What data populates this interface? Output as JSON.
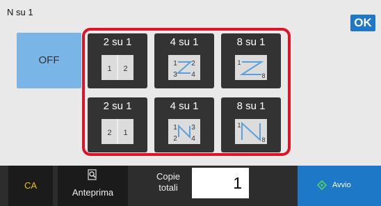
{
  "header": {
    "title": "N su 1",
    "ok_label": "OK"
  },
  "off_label": "OFF",
  "tiles": [
    {
      "label": "2 su 1",
      "pages": [
        "1",
        "2"
      ]
    },
    {
      "label": "4 su 1",
      "pages": [
        "1",
        "2",
        "3",
        "4"
      ]
    },
    {
      "label": "8 su 1",
      "pages": [
        "1",
        "8"
      ]
    },
    {
      "label": "2 su 1",
      "pages": [
        "2",
        "1"
      ]
    },
    {
      "label": "4 su 1",
      "pages": [
        "1",
        "3",
        "2",
        "4"
      ]
    },
    {
      "label": "8 su 1",
      "pages": [
        "1",
        "8"
      ]
    }
  ],
  "footer": {
    "ca_label": "CA",
    "preview_label": "Anteprima",
    "copies_line1": "Copie",
    "copies_line2": "totali",
    "copies_value": "1",
    "start_label": "Avvio"
  },
  "colors": {
    "accent": "#1e78c8",
    "selection_border": "#e01225",
    "off_button": "#79b5e6",
    "ca_text": "#f0c000"
  },
  "icons": {
    "preview": "magnifier-page-icon",
    "start": "diamond-start-icon"
  }
}
